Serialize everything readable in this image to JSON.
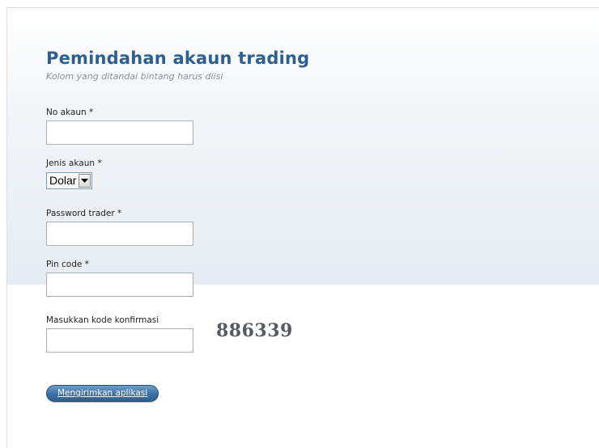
{
  "form": {
    "title": "Pemindahan akaun trading",
    "subtitle": "Kolom yang ditandai bintang harus diisi",
    "fields": {
      "account_no": {
        "label": "No akaun *",
        "value": ""
      },
      "account_type": {
        "label": "Jenis akaun *",
        "selected": "Dolar"
      },
      "trader_password": {
        "label": "Password trader *",
        "value": ""
      },
      "pin_code": {
        "label": "Pin code *",
        "value": ""
      },
      "confirm_code": {
        "label": "Masukkan kode konfirmasi",
        "value": "",
        "captcha": "886339"
      }
    },
    "submit_label": "Mengirimkan aplikasi"
  },
  "colors": {
    "title": "#2f5f8e",
    "button": "#3f74a4"
  }
}
